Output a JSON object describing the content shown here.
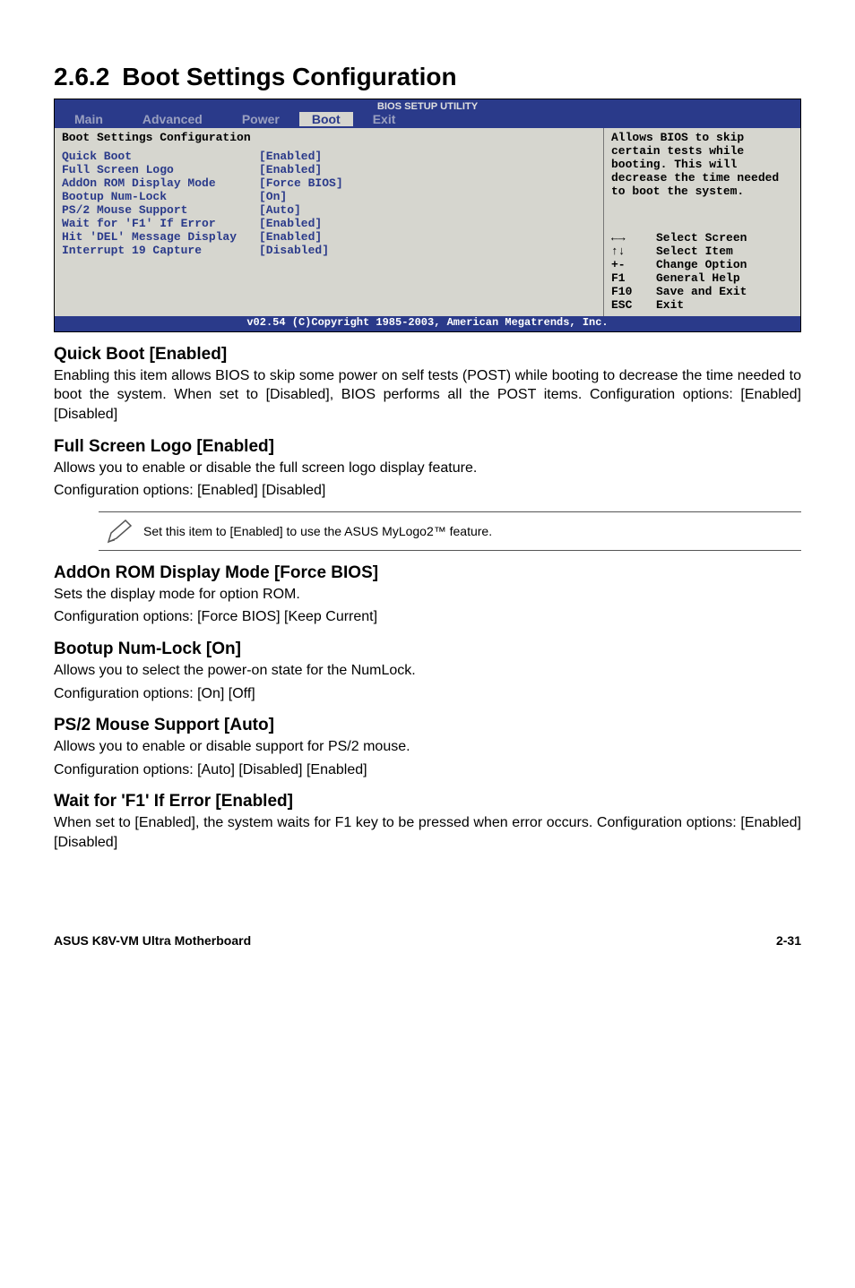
{
  "section": {
    "number": "2.6.2",
    "title": "Boot Settings Configuration"
  },
  "bios": {
    "title_line": "BIOS SETUP UTILITY",
    "menus": [
      "Main",
      "Advanced",
      "Power",
      "Boot",
      "Exit"
    ],
    "active_menu_index": 3,
    "panel_heading": "Boot Settings Configuration",
    "settings": [
      {
        "label": "Quick Boot",
        "value": "[Enabled]"
      },
      {
        "label": "Full Screen Logo",
        "value": "[Enabled]"
      },
      {
        "label": "AddOn ROM Display Mode",
        "value": "[Force BIOS]"
      },
      {
        "label": "Bootup Num-Lock",
        "value": "[On]"
      },
      {
        "label": "PS/2 Mouse Support",
        "value": "[Auto]"
      },
      {
        "label": "Wait for 'F1' If Error",
        "value": "[Enabled]"
      },
      {
        "label": "Hit 'DEL' Message Display",
        "value": "[Enabled]"
      },
      {
        "label": "Interrupt 19 Capture",
        "value": "[Disabled]"
      }
    ],
    "help_text": "Allows BIOS to skip certain tests while booting. This will decrease the time needed to boot the system.",
    "nav": [
      {
        "key": "←→",
        "action": "Select Screen"
      },
      {
        "key": "↑↓",
        "action": "Select Item"
      },
      {
        "key": "+-",
        "action": "Change Option"
      },
      {
        "key": "F1",
        "action": "General Help"
      },
      {
        "key": "F10",
        "action": "Save and Exit"
      },
      {
        "key": "ESC",
        "action": "Exit"
      }
    ],
    "footer": "v02.54 (C)Copyright 1985-2003, American Megatrends, Inc."
  },
  "options": [
    {
      "title": "Quick Boot [Enabled]",
      "paras": [
        "Enabling this item allows BIOS to skip some power on self tests (POST) while booting to decrease the time needed to boot the system. When set to [Disabled], BIOS performs all the POST items. Configuration options: [Enabled] [Disabled]"
      ],
      "justify": true
    },
    {
      "title": "Full Screen Logo [Enabled]",
      "paras": [
        "Allows you to enable or disable the full screen logo display feature.",
        "Configuration options: [Enabled] [Disabled]"
      ]
    },
    {
      "title": "AddOn ROM Display Mode [Force BIOS]",
      "paras": [
        "Sets the display mode for option ROM.",
        "Configuration options: [Force BIOS] [Keep Current]"
      ]
    },
    {
      "title": "Bootup Num-Lock [On]",
      "paras": [
        "Allows you to select the power-on state for the NumLock.",
        "Configuration options: [On] [Off]"
      ]
    },
    {
      "title": "PS/2 Mouse Support [Auto]",
      "paras": [
        "Allows you to enable or disable support for PS/2 mouse.",
        "Configuration options: [Auto] [Disabled] [Enabled]"
      ]
    },
    {
      "title": "Wait for 'F1' If Error [Enabled]",
      "paras": [
        "When set to [Enabled], the system waits for F1 key to be pressed when error occurs. Configuration options: [Enabled] [Disabled]"
      ],
      "justify": true
    }
  ],
  "note": {
    "text": "Set this item to [Enabled] to use the ASUS MyLogo2™ feature."
  },
  "footer": {
    "left": "ASUS K8V-VM Ultra Motherboard",
    "right": "2-31"
  }
}
